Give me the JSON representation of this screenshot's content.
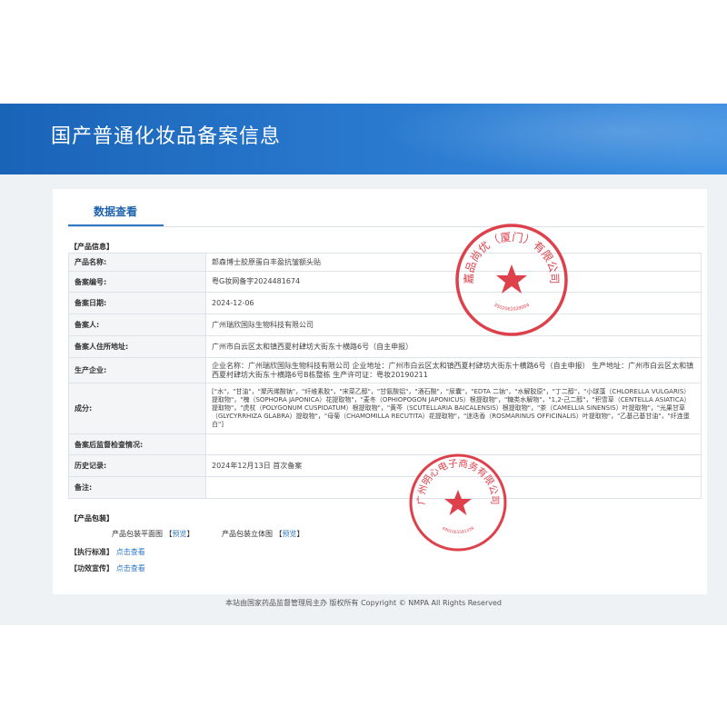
{
  "header": {
    "title": "国产普通化妆品备案信息"
  },
  "tab": {
    "label": "数据查看"
  },
  "sections": {
    "product_info": "【产品信息】",
    "product_packaging": "【产品包装】",
    "execution_standard": "【执行标准】",
    "efficacy_claim": "【功效宣传】"
  },
  "rows": [
    {
      "label": "产品名称:",
      "value": "郎森博士胶原蛋白丰盈抗皱额头贴"
    },
    {
      "label": "备案编号:",
      "value": "粤G妆网备字2024481674"
    },
    {
      "label": "备案日期:",
      "value": "2024-12-06"
    },
    {
      "label": "备案人:",
      "value": "广州瑞欣国际生物科技有限公司"
    },
    {
      "label": "备案人住所地址:",
      "value": "广州市白云区太和镇西夏村肆坊大街东十横路6号（自主申报）"
    },
    {
      "label": "生产企业:",
      "value": "企业名称：广州瑞欣国际生物科技有限公司 企业地址：广州市白云区太和镇西夏村肆坊大街东十横路6号（自主申报） 生产地址：广州市白云区太和镇西夏村肆坊大街东十横路6号B栋整栋 生产许可证：粤妆20190211"
    },
    {
      "label": "成分:",
      "value": "[\"水\"，\"甘油\"，\"聚丙烯酸钠\"，\"纤维素胶\"，\"宋菜乙醇\"，\"甘氨酸铝\"，\"酒石酸\"，\"尿囊\"，\"EDTA 二钠\"，\"水解胶原\"，\"丁二醇\"，\"小球藻（CHLORELLA VULGARIS）提取物\"，\"槐（SOPHORA JAPONICA）花提取物\"，\"麦冬（OPHIOPOGON JAPONICUS）根提取物\"，\"糖类水解物\"，\"1,2-己二醇\"，\"积雪草（CENTELLA ASIATICA）提取物\"，\"虎杖（POLYGONUM CUSPIDATUM）根提取物\"，\"黄芩（SCUTELLARIA BAICALENSIS）根提取物\"，\"茶（CAMELLIA SINENSIS）叶提取物\"，\"光果甘草（GLYCYRRHIZA GLABRA）提取物\"，\"母菊（CHAMOMILLA RECUTITA）花提取物\"，\"迷迭香（ROSMARINUS OFFICINALIS）叶提取物\"，\"乙基己基甘油\"，\"纤连蛋白\"]"
    },
    {
      "label": "备案后监督检查情况:",
      "value": ""
    },
    {
      "label": "历史记录:",
      "value": "2024年12月13日 首次备案"
    },
    {
      "label": "备注:",
      "value": ""
    }
  ],
  "packaging": {
    "flat_label": "产品包装平面图",
    "flat_link": "预览",
    "solid_label": "产品包装立体图",
    "solid_link": "预览",
    "bracket_open": "【",
    "bracket_close": "】"
  },
  "links": {
    "view": "点击查看"
  },
  "stamps": {
    "stamp1_text": "嘉品尚优（厦门）有限公司",
    "stamp1_number": "3502061029004",
    "stamp2_text": "广州明心电子商务有限公司",
    "stamp2_number": "4401061581339"
  },
  "colors": {
    "banner": "#1f6ec2",
    "accent": "#2d77c6",
    "stamp_red": "#d8202c"
  },
  "footer": {
    "text": "本站由国家药品监督管理局主办 版权所有 Copyright © NMPA All Rights Reserved"
  }
}
